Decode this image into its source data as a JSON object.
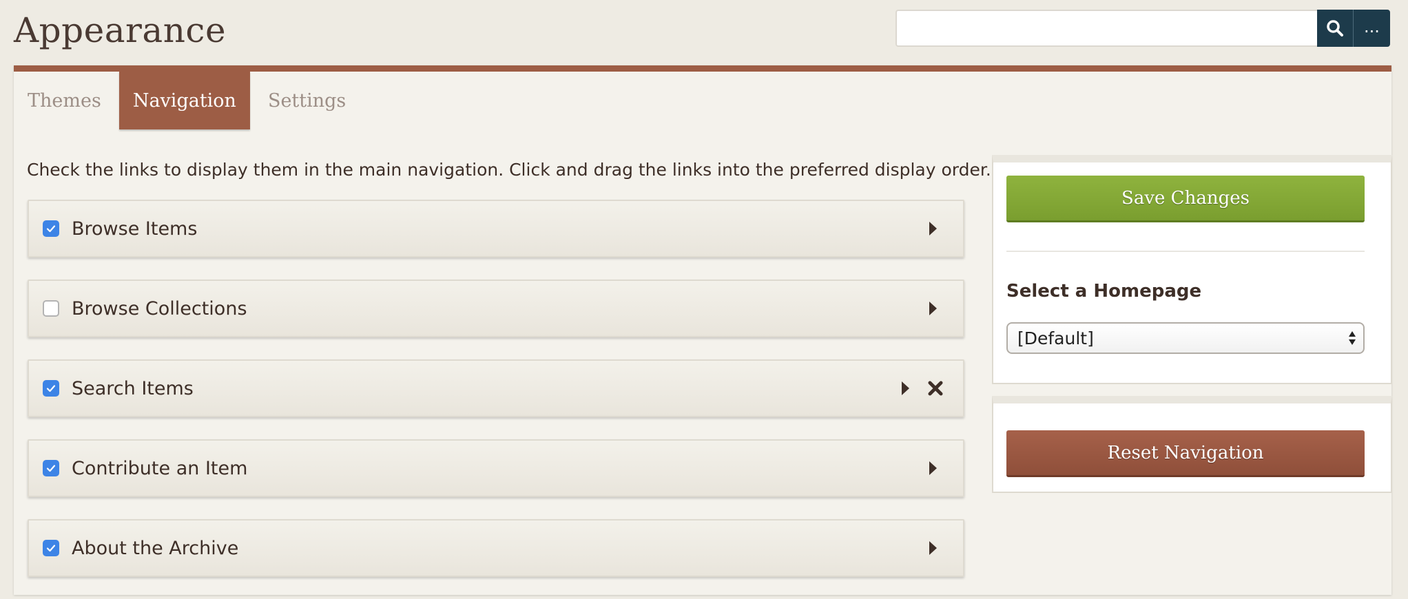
{
  "page": {
    "title": "Appearance"
  },
  "search": {
    "value": "",
    "placeholder": "",
    "advanced_label": "..."
  },
  "tabs": [
    {
      "label": "Themes",
      "active": false
    },
    {
      "label": "Navigation",
      "active": true
    },
    {
      "label": "Settings",
      "active": false
    }
  ],
  "instructions": "Check the links to display them in the main navigation. Click and drag the links into the preferred display order.",
  "nav_items": [
    {
      "label": "Browse Items",
      "checked": true,
      "deletable": false
    },
    {
      "label": "Browse Collections",
      "checked": false,
      "deletable": false
    },
    {
      "label": "Search Items",
      "checked": true,
      "deletable": true
    },
    {
      "label": "Contribute an Item",
      "checked": true,
      "deletable": false
    },
    {
      "label": "About the Archive",
      "checked": true,
      "deletable": false
    }
  ],
  "sidebar": {
    "save_label": "Save Changes",
    "homepage_label": "Select a Homepage",
    "homepage_value": "[Default]",
    "reset_label": "Reset Navigation"
  },
  "colors": {
    "accent": "#9d5d45",
    "save_button": "#86aa38",
    "search_button": "#1d3b4b",
    "checkbox": "#3d84e6",
    "background": "#eeebe3"
  },
  "icons": {
    "search": "search-icon",
    "expand": "expand-arrow-icon",
    "delete": "delete-icon",
    "check": "checkmark-icon"
  }
}
